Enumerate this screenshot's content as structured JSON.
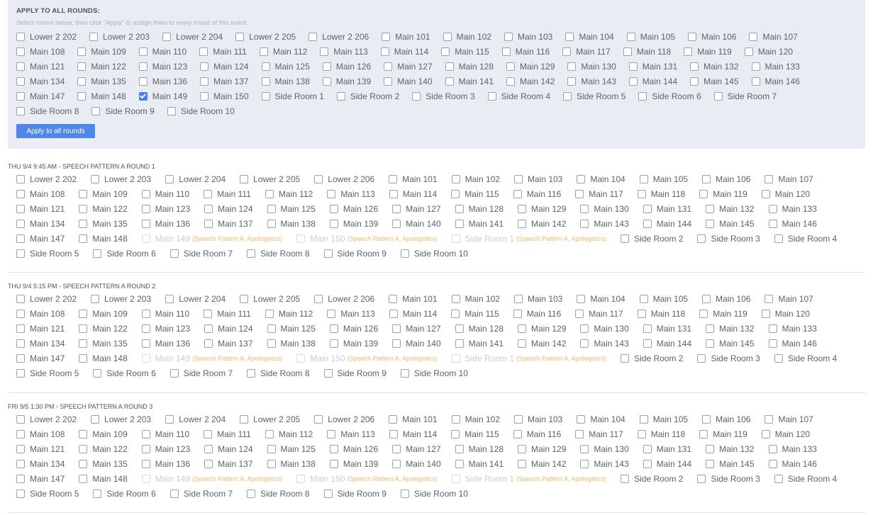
{
  "apply_panel": {
    "title": "APPLY TO ALL ROUNDS:",
    "subtitle": "Select rooms below, then click \"Apply\" to assign them to every round of this event.",
    "button_label": "Apply to all rounds",
    "rooms": [
      {
        "label": "Lower 2 202",
        "checked": false
      },
      {
        "label": "Lower 2 203",
        "checked": false
      },
      {
        "label": "Lower 2 204",
        "checked": false
      },
      {
        "label": "Lower 2 205",
        "checked": false
      },
      {
        "label": "Lower 2 206",
        "checked": false
      },
      {
        "label": "Main 101",
        "checked": false
      },
      {
        "label": "Main 102",
        "checked": false
      },
      {
        "label": "Main 103",
        "checked": false
      },
      {
        "label": "Main 104",
        "checked": false
      },
      {
        "label": "Main 105",
        "checked": false
      },
      {
        "label": "Main 106",
        "checked": false
      },
      {
        "label": "Main 107",
        "checked": false
      },
      {
        "label": "Main 108",
        "checked": false
      },
      {
        "label": "Main 109",
        "checked": false
      },
      {
        "label": "Main 110",
        "checked": false
      },
      {
        "label": "Main 111",
        "checked": false
      },
      {
        "label": "Main 112",
        "checked": false
      },
      {
        "label": "Main 113",
        "checked": false
      },
      {
        "label": "Main 114",
        "checked": false
      },
      {
        "label": "Main 115",
        "checked": false
      },
      {
        "label": "Main 116",
        "checked": false
      },
      {
        "label": "Main 117",
        "checked": false
      },
      {
        "label": "Main 118",
        "checked": false
      },
      {
        "label": "Main 119",
        "checked": false
      },
      {
        "label": "Main 120",
        "checked": false
      },
      {
        "label": "Main 121",
        "checked": false
      },
      {
        "label": "Main 122",
        "checked": false
      },
      {
        "label": "Main 123",
        "checked": false
      },
      {
        "label": "Main 124",
        "checked": false
      },
      {
        "label": "Main 125",
        "checked": false
      },
      {
        "label": "Main 126",
        "checked": false
      },
      {
        "label": "Main 127",
        "checked": false
      },
      {
        "label": "Main 128",
        "checked": false
      },
      {
        "label": "Main 129",
        "checked": false
      },
      {
        "label": "Main 130",
        "checked": false
      },
      {
        "label": "Main 131",
        "checked": false
      },
      {
        "label": "Main 132",
        "checked": false
      },
      {
        "label": "Main 133",
        "checked": false
      },
      {
        "label": "Main 134",
        "checked": false
      },
      {
        "label": "Main 135",
        "checked": false
      },
      {
        "label": "Main 136",
        "checked": false
      },
      {
        "label": "Main 137",
        "checked": false
      },
      {
        "label": "Main 138",
        "checked": false
      },
      {
        "label": "Main 139",
        "checked": false
      },
      {
        "label": "Main 140",
        "checked": false
      },
      {
        "label": "Main 141",
        "checked": false
      },
      {
        "label": "Main 142",
        "checked": false
      },
      {
        "label": "Main 143",
        "checked": false
      },
      {
        "label": "Main 144",
        "checked": false
      },
      {
        "label": "Main 145",
        "checked": false
      },
      {
        "label": "Main 146",
        "checked": false
      },
      {
        "label": "Main 147",
        "checked": false
      },
      {
        "label": "Main 148",
        "checked": false
      },
      {
        "label": "Main 149",
        "checked": true
      },
      {
        "label": "Main 150",
        "checked": false
      },
      {
        "label": "Side Room 1",
        "checked": false
      },
      {
        "label": "Side Room 2",
        "checked": false
      },
      {
        "label": "Side Room 3",
        "checked": false
      },
      {
        "label": "Side Room 4",
        "checked": false
      },
      {
        "label": "Side Room 5",
        "checked": false
      },
      {
        "label": "Side Room 6",
        "checked": false
      },
      {
        "label": "Side Room 7",
        "checked": false
      },
      {
        "label": "Side Room 8",
        "checked": false
      },
      {
        "label": "Side Room 9",
        "checked": false
      },
      {
        "label": "Side Room 10",
        "checked": false
      }
    ]
  },
  "rounds": [
    {
      "title": "THU 9/4 9:45 AM - SPEECH PATTERN A ROUND 1",
      "rooms": [
        {
          "label": "Lower 2 202"
        },
        {
          "label": "Lower 2 203"
        },
        {
          "label": "Lower 2 204"
        },
        {
          "label": "Lower 2 205"
        },
        {
          "label": "Lower 2 206"
        },
        {
          "label": "Main 101"
        },
        {
          "label": "Main 102"
        },
        {
          "label": "Main 103"
        },
        {
          "label": "Main 104"
        },
        {
          "label": "Main 105"
        },
        {
          "label": "Main 106"
        },
        {
          "label": "Main 107"
        },
        {
          "label": "Main 108"
        },
        {
          "label": "Main 109"
        },
        {
          "label": "Main 110"
        },
        {
          "label": "Main 111"
        },
        {
          "label": "Main 112"
        },
        {
          "label": "Main 113"
        },
        {
          "label": "Main 114"
        },
        {
          "label": "Main 115"
        },
        {
          "label": "Main 116"
        },
        {
          "label": "Main 117"
        },
        {
          "label": "Main 118"
        },
        {
          "label": "Main 119"
        },
        {
          "label": "Main 120"
        },
        {
          "label": "Main 121"
        },
        {
          "label": "Main 122"
        },
        {
          "label": "Main 123"
        },
        {
          "label": "Main 124"
        },
        {
          "label": "Main 125"
        },
        {
          "label": "Main 126"
        },
        {
          "label": "Main 127"
        },
        {
          "label": "Main 128"
        },
        {
          "label": "Main 129"
        },
        {
          "label": "Main 130"
        },
        {
          "label": "Main 131"
        },
        {
          "label": "Main 132"
        },
        {
          "label": "Main 133"
        },
        {
          "label": "Main 134"
        },
        {
          "label": "Main 135"
        },
        {
          "label": "Main 136"
        },
        {
          "label": "Main 137"
        },
        {
          "label": "Main 138"
        },
        {
          "label": "Main 139"
        },
        {
          "label": "Main 140"
        },
        {
          "label": "Main 141"
        },
        {
          "label": "Main 142"
        },
        {
          "label": "Main 143"
        },
        {
          "label": "Main 144"
        },
        {
          "label": "Main 145"
        },
        {
          "label": "Main 146"
        },
        {
          "label": "Main 147"
        },
        {
          "label": "Main 148"
        },
        {
          "label": "Main 149",
          "disabled": true,
          "note": "(Speech Pattern A, Apologetics)"
        },
        {
          "label": "Main 150",
          "disabled": true,
          "note": "(Speech Pattern A, Apologetics)"
        },
        {
          "label": "Side Room 1",
          "disabled": true,
          "note": "(Speech Pattern A, Apologetics)"
        },
        {
          "label": "Side Room 2"
        },
        {
          "label": "Side Room 3"
        },
        {
          "label": "Side Room 4"
        },
        {
          "label": "Side Room 5"
        },
        {
          "label": "Side Room 6"
        },
        {
          "label": "Side Room 7"
        },
        {
          "label": "Side Room 8"
        },
        {
          "label": "Side Room 9"
        },
        {
          "label": "Side Room 10"
        }
      ]
    },
    {
      "title": "THU 9/4 5:15 PM - SPEECH PATTERN A ROUND 2",
      "rooms": [
        {
          "label": "Lower 2 202"
        },
        {
          "label": "Lower 2 203"
        },
        {
          "label": "Lower 2 204"
        },
        {
          "label": "Lower 2 205"
        },
        {
          "label": "Lower 2 206"
        },
        {
          "label": "Main 101"
        },
        {
          "label": "Main 102"
        },
        {
          "label": "Main 103"
        },
        {
          "label": "Main 104"
        },
        {
          "label": "Main 105"
        },
        {
          "label": "Main 106"
        },
        {
          "label": "Main 107"
        },
        {
          "label": "Main 108"
        },
        {
          "label": "Main 109"
        },
        {
          "label": "Main 110"
        },
        {
          "label": "Main 111"
        },
        {
          "label": "Main 112"
        },
        {
          "label": "Main 113"
        },
        {
          "label": "Main 114"
        },
        {
          "label": "Main 115"
        },
        {
          "label": "Main 116"
        },
        {
          "label": "Main 117"
        },
        {
          "label": "Main 118"
        },
        {
          "label": "Main 119"
        },
        {
          "label": "Main 120"
        },
        {
          "label": "Main 121"
        },
        {
          "label": "Main 122"
        },
        {
          "label": "Main 123"
        },
        {
          "label": "Main 124"
        },
        {
          "label": "Main 125"
        },
        {
          "label": "Main 126"
        },
        {
          "label": "Main 127"
        },
        {
          "label": "Main 128"
        },
        {
          "label": "Main 129"
        },
        {
          "label": "Main 130"
        },
        {
          "label": "Main 131"
        },
        {
          "label": "Main 132"
        },
        {
          "label": "Main 133"
        },
        {
          "label": "Main 134"
        },
        {
          "label": "Main 135"
        },
        {
          "label": "Main 136"
        },
        {
          "label": "Main 137"
        },
        {
          "label": "Main 138"
        },
        {
          "label": "Main 139"
        },
        {
          "label": "Main 140"
        },
        {
          "label": "Main 141"
        },
        {
          "label": "Main 142"
        },
        {
          "label": "Main 143"
        },
        {
          "label": "Main 144"
        },
        {
          "label": "Main 145"
        },
        {
          "label": "Main 146"
        },
        {
          "label": "Main 147"
        },
        {
          "label": "Main 148"
        },
        {
          "label": "Main 149",
          "disabled": true,
          "note": "(Speech Pattern A, Apologetics)"
        },
        {
          "label": "Main 150",
          "disabled": true,
          "note": "(Speech Pattern A, Apologetics)"
        },
        {
          "label": "Side Room 1",
          "disabled": true,
          "note": "(Speech Pattern A, Apologetics)"
        },
        {
          "label": "Side Room 2"
        },
        {
          "label": "Side Room 3"
        },
        {
          "label": "Side Room 4"
        },
        {
          "label": "Side Room 5"
        },
        {
          "label": "Side Room 6"
        },
        {
          "label": "Side Room 7"
        },
        {
          "label": "Side Room 8"
        },
        {
          "label": "Side Room 9"
        },
        {
          "label": "Side Room 10"
        }
      ]
    },
    {
      "title": "FRI 9/5 1:30 PM - SPEECH PATTERN A ROUND 3",
      "rooms": [
        {
          "label": "Lower 2 202"
        },
        {
          "label": "Lower 2 203"
        },
        {
          "label": "Lower 2 204"
        },
        {
          "label": "Lower 2 205"
        },
        {
          "label": "Lower 2 206"
        },
        {
          "label": "Main 101"
        },
        {
          "label": "Main 102"
        },
        {
          "label": "Main 103"
        },
        {
          "label": "Main 104"
        },
        {
          "label": "Main 105"
        },
        {
          "label": "Main 106"
        },
        {
          "label": "Main 107"
        },
        {
          "label": "Main 108"
        },
        {
          "label": "Main 109"
        },
        {
          "label": "Main 110"
        },
        {
          "label": "Main 111"
        },
        {
          "label": "Main 112"
        },
        {
          "label": "Main 113"
        },
        {
          "label": "Main 114"
        },
        {
          "label": "Main 115"
        },
        {
          "label": "Main 116"
        },
        {
          "label": "Main 117"
        },
        {
          "label": "Main 118"
        },
        {
          "label": "Main 119"
        },
        {
          "label": "Main 120"
        },
        {
          "label": "Main 121"
        },
        {
          "label": "Main 122"
        },
        {
          "label": "Main 123"
        },
        {
          "label": "Main 124"
        },
        {
          "label": "Main 125"
        },
        {
          "label": "Main 126"
        },
        {
          "label": "Main 127"
        },
        {
          "label": "Main 128"
        },
        {
          "label": "Main 129"
        },
        {
          "label": "Main 130"
        },
        {
          "label": "Main 131"
        },
        {
          "label": "Main 132"
        },
        {
          "label": "Main 133"
        },
        {
          "label": "Main 134"
        },
        {
          "label": "Main 135"
        },
        {
          "label": "Main 136"
        },
        {
          "label": "Main 137"
        },
        {
          "label": "Main 138"
        },
        {
          "label": "Main 139"
        },
        {
          "label": "Main 140"
        },
        {
          "label": "Main 141"
        },
        {
          "label": "Main 142"
        },
        {
          "label": "Main 143"
        },
        {
          "label": "Main 144"
        },
        {
          "label": "Main 145"
        },
        {
          "label": "Main 146"
        },
        {
          "label": "Main 147"
        },
        {
          "label": "Main 148"
        },
        {
          "label": "Main 149",
          "disabled": true,
          "note": "(Speech Pattern A, Apologetics)"
        },
        {
          "label": "Main 150",
          "disabled": true,
          "note": "(Speech Pattern A, Apologetics)"
        },
        {
          "label": "Side Room 1",
          "disabled": true,
          "note": "(Speech Pattern A, Apologetics)"
        },
        {
          "label": "Side Room 2"
        },
        {
          "label": "Side Room 3"
        },
        {
          "label": "Side Room 4"
        },
        {
          "label": "Side Room 5"
        },
        {
          "label": "Side Room 6"
        },
        {
          "label": "Side Room 7"
        },
        {
          "label": "Side Room 8"
        },
        {
          "label": "Side Room 9"
        },
        {
          "label": "Side Room 10"
        }
      ]
    }
  ],
  "colors": {
    "accent": "#4f87e8",
    "panel_bg": "#e9ecf2",
    "conflict_note": "#f0b870",
    "disabled_text": "#c9ced6"
  }
}
